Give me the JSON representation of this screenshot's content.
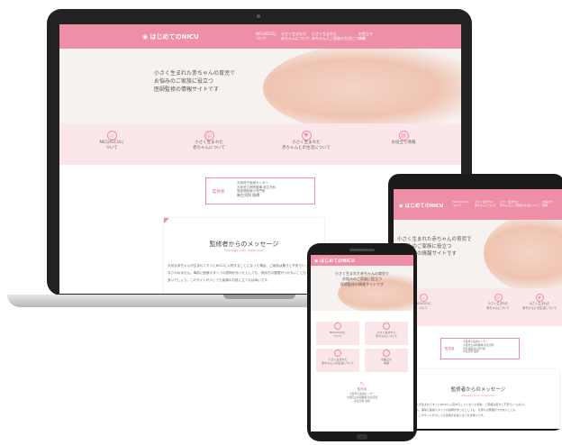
{
  "site": {
    "logo": "はじめてのNICU",
    "nav": [
      {
        "line1": "NICU/GCUに",
        "line2": "ついて"
      },
      {
        "line1": "小さく生まれた",
        "line2": "赤ちゃんについて"
      },
      {
        "line1": "小さく生まれた",
        "line2": "赤ちゃんとご家族の生活について"
      },
      {
        "line1": "お役立ち",
        "line2": "情報"
      }
    ],
    "hero": {
      "line1": "小さく生まれた赤ちゃんの育児で",
      "line2": "お悩みのご家族に役立つ",
      "line3": "医師監修の情報サイトです"
    },
    "cards": [
      {
        "icon": "bed-icon",
        "line1": "NICU/GCUに",
        "line2": "ついて"
      },
      {
        "icon": "baby-icon",
        "line1": "小さく生まれた",
        "line2": "赤ちゃんについて"
      },
      {
        "icon": "family-icon",
        "line1": "小さく生まれた",
        "line2": "赤ちゃんとの生活について"
      },
      {
        "icon": "book-icon",
        "line1": "お役立ち情報",
        "line2": ""
      }
    ],
    "supervisor": {
      "badge": "監修者",
      "line1": "大阪母子医療センター",
      "line2": "大阪府立病院機構 新生児科",
      "line3": "周産期医療の専門家",
      "name": "新生児科 医師"
    },
    "message": {
      "title": "監修者からのメッセージ",
      "subtitle": "Message from Supervisor",
      "body1": "大切な赤ちゃんが生まれてすぐにNICUに入院することになった場合、ご家族は驚きと不安でいっぱいに",
      "body2": "なりかねません。事前に医療スタッフの説明があったとしても、気持ちの整理がつかないことも",
      "body3": "多いでしょう。このサイトが少しでも皆様のお役に立てれば幸いです。"
    }
  },
  "phone": {
    "cells": [
      {
        "line1": "NICU/GCUに",
        "line2": "ついて"
      },
      {
        "line1": "小さく生まれた",
        "line2": "赤ちゃんについて"
      },
      {
        "line1": "小さく生まれた",
        "line2": "赤ちゃんとの生活について"
      },
      {
        "line1": "お役立ち",
        "line2": "情報"
      }
    ]
  },
  "colors": {
    "accent": "#ee8fa7",
    "pale_pink": "#fbe6ea",
    "hero_bg": "#f6f2f0",
    "device_frame": "#1b1b1b"
  }
}
